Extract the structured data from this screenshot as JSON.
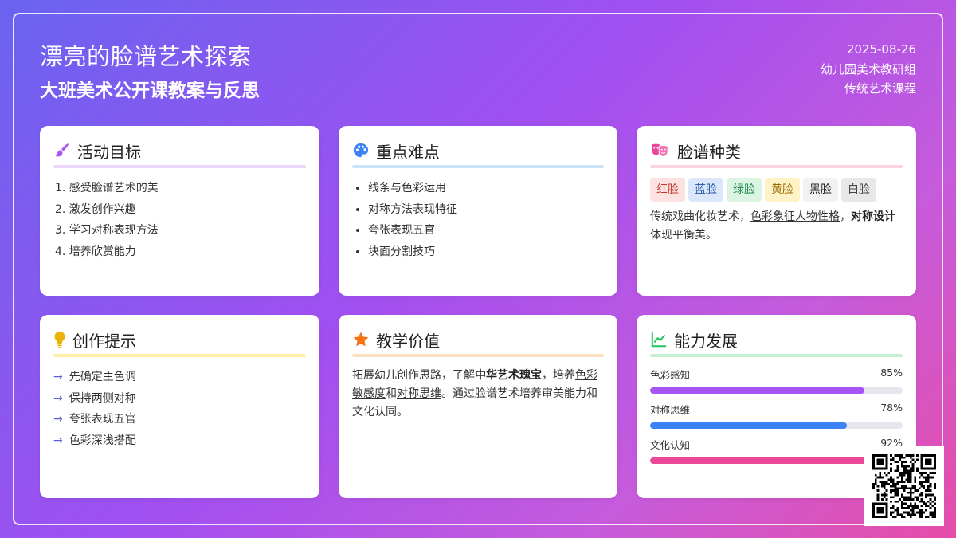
{
  "header": {
    "title": "漂亮的脸谱艺术探索",
    "subtitle": "大班美术公开课教案与反思",
    "date": "2025-08-26",
    "group": "幼儿园美术教研组",
    "course": "传统艺术课程"
  },
  "cards": {
    "goals": {
      "title": "活动目标",
      "icon": "paintbrush-icon",
      "color": "#a855f7",
      "items": [
        "1. 感受脸谱艺术的美",
        "2. 激发创作兴趣",
        "3. 学习对称表现方法",
        "4. 培养欣赏能力"
      ]
    },
    "keypoints": {
      "title": "重点难点",
      "icon": "palette-icon",
      "color": "#3b82f6",
      "items": [
        "线条与色彩运用",
        "对称方法表现特征",
        "夸张表现五官",
        "块面分割技巧"
      ]
    },
    "types": {
      "title": "脸谱种类",
      "icon": "theater-masks-icon",
      "color": "#ec4899",
      "tags": [
        "红脸",
        "蓝脸",
        "绿脸",
        "黄脸",
        "黑脸",
        "白脸"
      ],
      "desc_1": "传统戏曲化妆艺术，",
      "desc_2": "色彩象征人物性格",
      "desc_3": "，",
      "desc_4": "对称设计",
      "desc_5": "体现平衡美。"
    },
    "tips": {
      "title": "创作提示",
      "icon": "lightbulb-icon",
      "color": "#eab308",
      "items": [
        "先确定主色调",
        "保持两侧对称",
        "夸张表现五官",
        "色彩深浅搭配"
      ]
    },
    "value": {
      "title": "教学价值",
      "icon": "star-icon",
      "color": "#f97316",
      "p1": "拓展幼儿创作思路，了解",
      "p2": "中华艺术瑰宝",
      "p3": "，培养",
      "p4": "色彩敏感度",
      "p5": "和",
      "p6": "对称思维",
      "p7": "。通过脸谱艺术培养审美能力和文化认同。"
    },
    "ability": {
      "title": "能力发展",
      "icon": "chart-line-icon",
      "color": "#22c55e",
      "items": [
        {
          "label": "色彩感知",
          "value": "85%",
          "fraction": 0.85,
          "color": "#a855f7"
        },
        {
          "label": "对称思维",
          "value": "78%",
          "fraction": 0.78,
          "color": "#3b82f6"
        },
        {
          "label": "文化认知",
          "value": "92%",
          "fraction": 0.92,
          "color": "#ec4899"
        }
      ]
    }
  }
}
